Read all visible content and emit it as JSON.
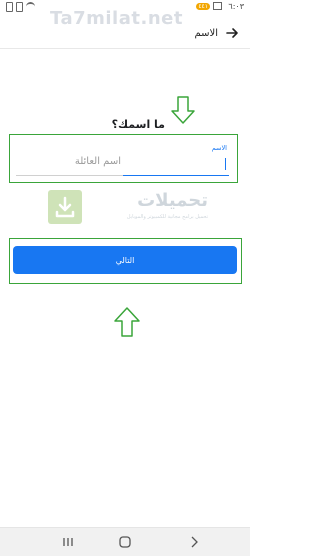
{
  "status_bar": {
    "time": "٦:٠٣",
    "badge": "٤٤١"
  },
  "watermark": {
    "top_text": "Ta7milat.net",
    "logo_text": "تحميلات",
    "logo_subtext": "تحميل برامج مجانية للكمبيوتر والموبايل"
  },
  "app_bar": {
    "title": "الاسم",
    "back_icon": "arrow-right-icon"
  },
  "form": {
    "question": "ما اسمك؟",
    "first_name_label": "الاسم",
    "first_name_value": "",
    "last_name_placeholder": "اسم العائلة"
  },
  "next_button": {
    "label": "التالي"
  },
  "colors": {
    "accent": "#1877f2",
    "highlight": "#3aa53a"
  },
  "nav_bar": {
    "recents_icon": "recents-icon",
    "home_icon": "home-icon",
    "back_icon": "back-chevron-icon"
  }
}
